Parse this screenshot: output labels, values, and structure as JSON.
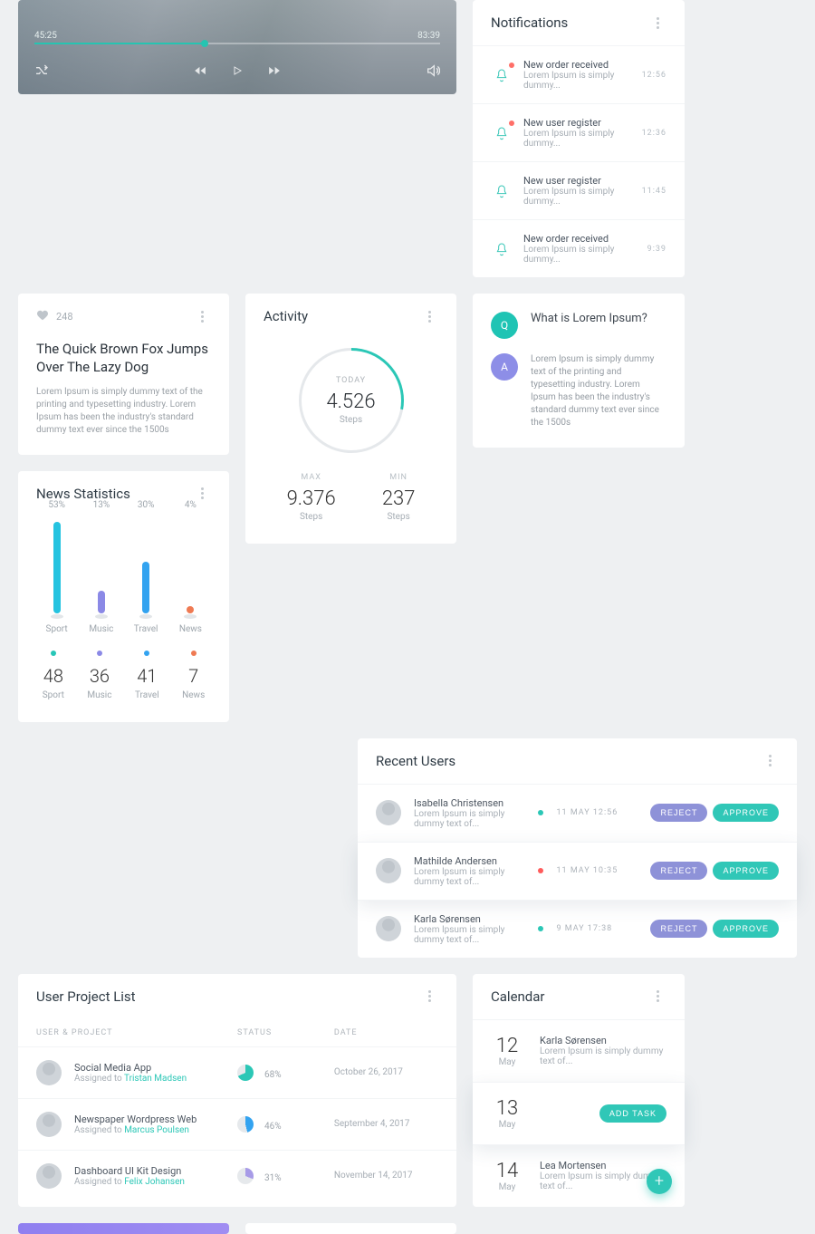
{
  "player": {
    "current": "45:25",
    "duration": "83:39"
  },
  "post": {
    "likes": "248",
    "title_l1": "The Quick Brown Fox Jumps",
    "title_l2": "Over The Lazy Dog",
    "body": "Lorem Ipsum is simply dummy text of the printing and typesetting industry. Lorem Ipsum has been the industry's standard dummy text ever since the 1500s"
  },
  "activity": {
    "title": "Activity",
    "today_label": "TODAY",
    "today_value": "4.526",
    "today_unit": "Steps",
    "max_label": "MAX",
    "max_value": "9.376",
    "max_unit": "Steps",
    "min_label": "MIN",
    "min_value": "237",
    "min_unit": "Steps"
  },
  "notifications": {
    "title": "Notifications",
    "items": [
      {
        "title": "New order received",
        "desc": "Lorem Ipsum is simply dummy...",
        "time": "12:56",
        "has": true
      },
      {
        "title": "New user register",
        "desc": "Lorem Ipsum is simply dummy...",
        "time": "12:36",
        "has": true
      },
      {
        "title": "New user register",
        "desc": "Lorem Ipsum is simply dummy...",
        "time": "11:45",
        "has": false
      },
      {
        "title": "New order received",
        "desc": "Lorem Ipsum is simply dummy...",
        "time": "9:39",
        "has": false
      }
    ]
  },
  "news": {
    "title": "News Statistics",
    "bars": [
      {
        "label": "Sport",
        "pct": "53%",
        "value": 53,
        "color": "#25c3e0"
      },
      {
        "label": "Music",
        "pct": "13%",
        "value": 13,
        "color": "#8b89e6"
      },
      {
        "label": "Travel",
        "pct": "30%",
        "value": 30,
        "color": "#33a3f0"
      },
      {
        "label": "News",
        "pct": "4%",
        "value": 4,
        "color": "#ef7a53"
      }
    ],
    "legend": [
      {
        "label": "Sport",
        "num": "48",
        "color": "#27c6b7"
      },
      {
        "label": "Music",
        "num": "36",
        "color": "#8b89e6"
      },
      {
        "label": "Travel",
        "num": "41",
        "color": "#33a3f0"
      },
      {
        "label": "News",
        "num": "7",
        "color": "#ef7a53"
      }
    ]
  },
  "qa": {
    "q_avatar": "Q",
    "q_text": "What is Lorem Ipsum?",
    "a_avatar": "A",
    "a_text": "Lorem Ipsum is simply dummy text of the printing and typesetting industry. Lorem Ipsum has been the industry's standard dummy text ever since the 1500s"
  },
  "recent": {
    "title": "Recent Users",
    "items": [
      {
        "name": "Isabella Christensen",
        "desc": "Lorem Ipsum is simply dummy text of...",
        "dot": "#2bc7b6",
        "time": "11 MAY 12:56"
      },
      {
        "name": "Mathilde Andersen",
        "desc": "Lorem Ipsum is simply dummy text of...",
        "dot": "#ff5b5b",
        "time": "11 MAY 10:35",
        "hl": true
      },
      {
        "name": "Karla Sørensen",
        "desc": "Lorem Ipsum is simply dummy text of...",
        "dot": "#2bc7b6",
        "time": "9 MAY 17:38"
      }
    ],
    "btn_reject": "REJECT",
    "btn_approve": "APPROVE"
  },
  "plist": {
    "title": "User Project List",
    "h1": "USER & PROJECT",
    "h2": "STATUS",
    "h3": "DATE",
    "items": [
      {
        "title": "Social Media App",
        "assigned_prefix": "Assigned to ",
        "assignee": "Tristan Madsen",
        "pct": 68,
        "pctLabel": "68%",
        "date": "October 26, 2017",
        "color": "#2bc7b6"
      },
      {
        "title": "Newspaper Wordpress Web",
        "assigned_prefix": "Assigned to ",
        "assignee": "Marcus Poulsen",
        "pct": 46,
        "pctLabel": "46%",
        "date": "September 4, 2017",
        "color": "#33a3f0"
      },
      {
        "title": "Dashboard UI Kit Design",
        "assigned_prefix": "Assigned to ",
        "assignee": "Felix Johansen",
        "pct": 31,
        "pctLabel": "31%",
        "date": "November 14, 2017",
        "color": "#a79be7"
      }
    ]
  },
  "calendar": {
    "title": "Calendar",
    "btn_add": "ADD TASK",
    "items": [
      {
        "day": "12",
        "month": "May",
        "title": "Karla Sørensen",
        "desc": "Lorem Ipsum is simply dummy text of..."
      },
      {
        "day": "13",
        "month": "May",
        "hl": true
      },
      {
        "day": "14",
        "month": "May",
        "title": "Lea Mortensen",
        "desc": "Lorem Ipsum is simply dummy text of..."
      }
    ]
  },
  "chart_data": {
    "type": "bar",
    "categories": [
      "Sport",
      "Music",
      "Travel",
      "News"
    ],
    "values": [
      53,
      13,
      30,
      4
    ],
    "title": "News Statistics",
    "ylabel": "percent",
    "ylim": [
      0,
      60
    ]
  }
}
